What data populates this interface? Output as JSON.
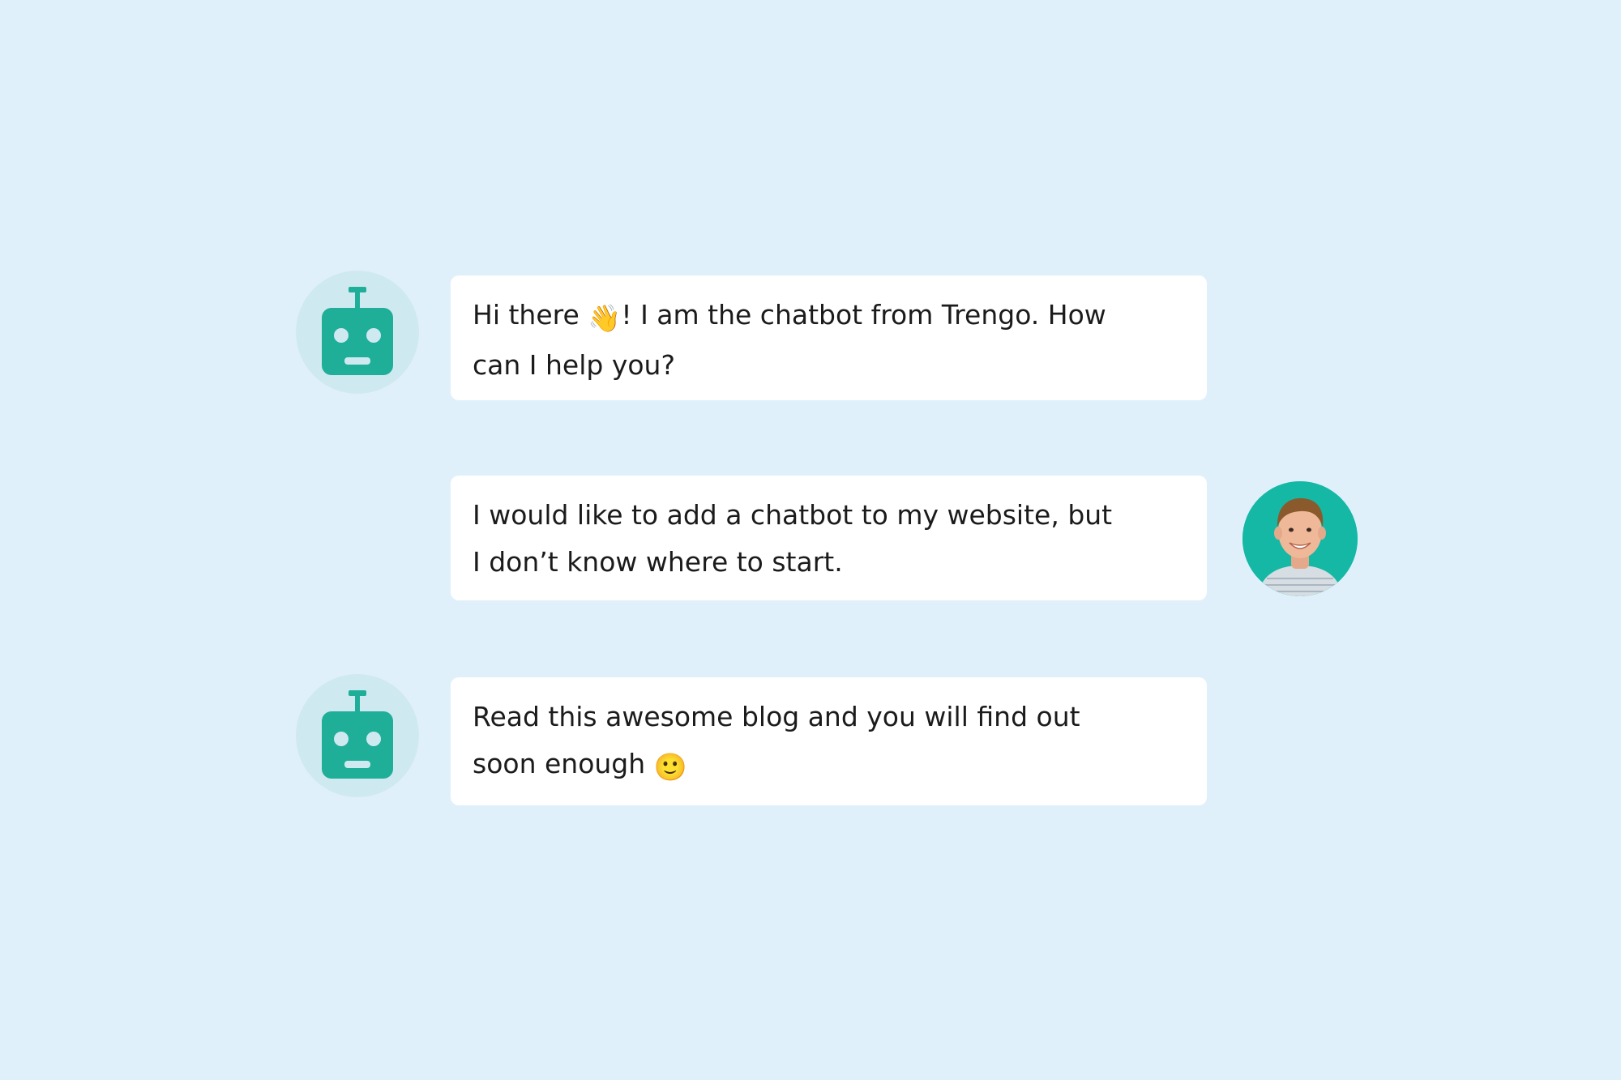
{
  "colors": {
    "background": "#e0f0fb",
    "bubble": "#ffffff",
    "bot_icon": "#1fae98",
    "bot_avatar_bg": "#cfe9f1",
    "user_avatar_bg": "#15b8a5",
    "text": "#1b1b1b"
  },
  "messages": [
    {
      "sender": "bot",
      "avatar_icon": "robot-icon",
      "parts": [
        "Hi there ",
        "👋",
        "! I am the chatbot from Trengo. How can I help you?"
      ]
    },
    {
      "sender": "user",
      "avatar_icon": "user-photo-avatar",
      "parts": [
        "I would like to add a chatbot to my website, but I don’t know where to start."
      ]
    },
    {
      "sender": "bot",
      "avatar_icon": "robot-icon",
      "parts": [
        "Read this awesome blog and you will find out soon enough ",
        "🙂"
      ]
    }
  ]
}
